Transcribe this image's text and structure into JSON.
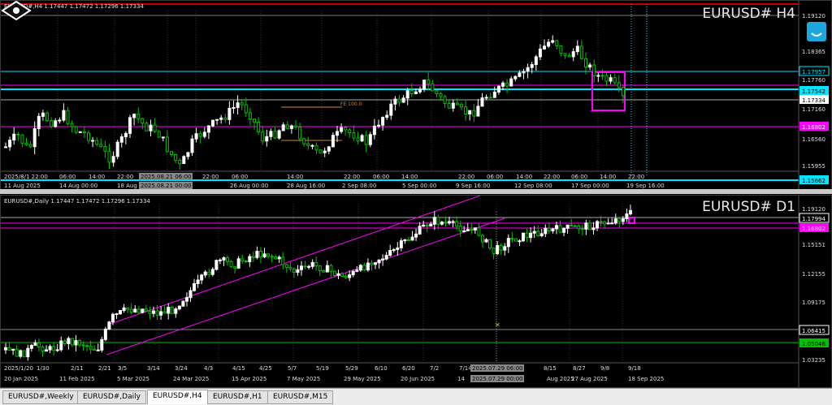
{
  "app": {
    "logo": "logo-icon"
  },
  "colors": {
    "up": "#ffffff",
    "down": "#00c000",
    "cyan": "#00e5ff",
    "magenta": "#ff00ff",
    "orange": "#d08a2a",
    "grid": "#2a2a2a",
    "price_bg_cyan": "#00e5ff"
  },
  "chart_h4": {
    "header": "EURUSD#,H4  1.17447 1.17472 1.17296 1.17334",
    "watermark": "EURUSD# H4",
    "fe_label": "FE 100.0",
    "price_labels": [
      {
        "text": "1.19120",
        "style": "plain"
      },
      {
        "text": "1.18365",
        "style": "plain"
      },
      {
        "text": "1.17957",
        "style": "cyan-box"
      },
      {
        "text": "1.17760",
        "style": "plain"
      },
      {
        "text": "1.17542",
        "style": "cyan-fill"
      },
      {
        "text": "1.17334",
        "style": "white-fill"
      },
      {
        "text": "1.17160",
        "style": "plain"
      },
      {
        "text": "1.16802",
        "style": "magenta-fill"
      },
      {
        "text": "1.16560",
        "style": "plain"
      },
      {
        "text": "1.15955",
        "style": "plain"
      },
      {
        "text": "1.15662",
        "style": "cyan-fill"
      }
    ],
    "time_labels": [
      "2025/8/1 22:00",
      "06:00",
      "14:00",
      "22:00",
      "2025.08.21 06:00",
      "22:00",
      "06:00",
      "14:00",
      "22:00",
      "06:00",
      "14:00",
      "22:00",
      "06:00",
      "14:00",
      "22:00",
      "06:00",
      "14:00",
      "22:00"
    ],
    "date_labels": [
      "11 Aug 2025",
      "14 Aug 00:00",
      "18 Aug",
      "2025.08.21 00:00",
      "26 Aug 00:00",
      "28 Aug 16:00",
      "2 Sep 08:00",
      "5 Sep 00:00",
      "9 Sep 16:00",
      "12 Sep 08:00",
      "17 Sep 00:00",
      "19 Sep 16:00"
    ]
  },
  "chart_d1": {
    "header": "EURUSD#,Daily  1.17447 1.17472 1.17296 1.17334",
    "watermark": "EURUSD# D1",
    "price_labels": [
      {
        "text": "1.19120",
        "style": "plain"
      },
      {
        "text": "1.17994",
        "style": "white-box"
      },
      {
        "text": "1.16802",
        "style": "magenta-fill"
      },
      {
        "text": "1.15151",
        "style": "plain"
      },
      {
        "text": "1.12155",
        "style": "plain"
      },
      {
        "text": "1.09175",
        "style": "plain"
      },
      {
        "text": "1.06415",
        "style": "white-box"
      },
      {
        "text": "1.05046",
        "style": "green-fill"
      },
      {
        "text": "1.03235",
        "style": "plain"
      }
    ],
    "time_labels": [
      "2025/1/20",
      "1/30",
      "2/11",
      "2/21",
      "3/5",
      "3/14",
      "3/24",
      "4/3",
      "4/15",
      "4/25",
      "5/7",
      "5/19",
      "5/29",
      "6/10",
      "6/20",
      "7/2",
      "7/14",
      "2025.07.29 06:00",
      "8/15",
      "8/27",
      "9/8",
      "9/18"
    ],
    "date_labels": [
      "20 Jan 2025",
      "11 Feb 2025",
      "5 Mar 2025",
      "24 Mar 2025",
      "15 Apr 2025",
      "7 May 2025",
      "29 May 2025",
      "20 Jun 2025",
      "14",
      "2025.07.29 00:00",
      "Aug 2025",
      "27 Aug 2025",
      "18 Sep 2025"
    ]
  },
  "tabs": [
    {
      "label": "EURUSD#,Weekly",
      "active": false
    },
    {
      "label": "EURUSD#,Daily",
      "active": false
    },
    {
      "label": "EURUSD#,H4",
      "active": true
    },
    {
      "label": "EURUSD#,H1",
      "active": false
    },
    {
      "label": "EURUSD#,M15",
      "active": false
    }
  ]
}
